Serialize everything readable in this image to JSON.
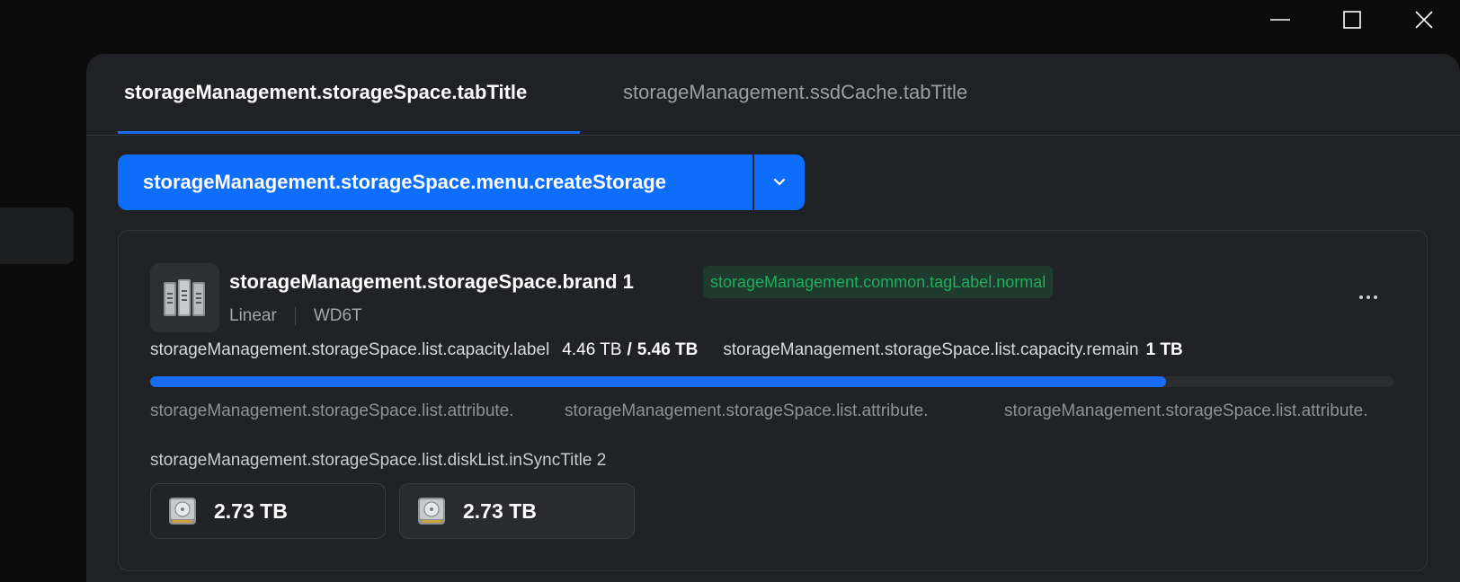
{
  "window": {
    "minimize_icon": "minimize-icon",
    "maximize_icon": "maximize-icon",
    "close_icon": "close-icon"
  },
  "tabs": [
    {
      "label": "storageManagement.storageSpace.tabTitle",
      "active": true
    },
    {
      "label": "storageManagement.ssdCache.tabTitle",
      "active": false
    }
  ],
  "actions": {
    "create_label": "storageManagement.storageSpace.menu.createStorage",
    "dropdown_icon": "chevron-down-icon"
  },
  "storage": {
    "icon": "server-rack-icon",
    "title": "storageManagement.storageSpace.brand 1",
    "status": "storageManagement.common.tagLabel.normal",
    "status_color": "#1fae5b",
    "raid_type": "Linear",
    "model": "WD6T",
    "more_icon": "more-horizontal-icon",
    "capacity_label": "storageManagement.storageSpace.list.capacity.label",
    "used": "4.46 TB",
    "slash": "/",
    "total": "5.46 TB",
    "remain_label": "storageManagement.storageSpace.list.capacity.remain",
    "remain": "1 TB",
    "usage_fraction": 0.817,
    "progress_color": "#1a6cf5",
    "attributes": [
      "storageManagement.storageSpace.list.attribute.",
      "storageManagement.storageSpace.list.attribute.",
      "storageManagement.storageSpace.list.attribute."
    ],
    "disk_list_title": "storageManagement.storageSpace.list.diskList.inSyncTitle 2",
    "disks": [
      {
        "icon": "hard-disk-icon",
        "size": "2.73 TB"
      },
      {
        "icon": "hard-disk-icon",
        "size": "2.73 TB"
      }
    ]
  },
  "colors": {
    "accent": "#0d6efd",
    "background": "#0b0b0c",
    "panel": "#202124"
  }
}
